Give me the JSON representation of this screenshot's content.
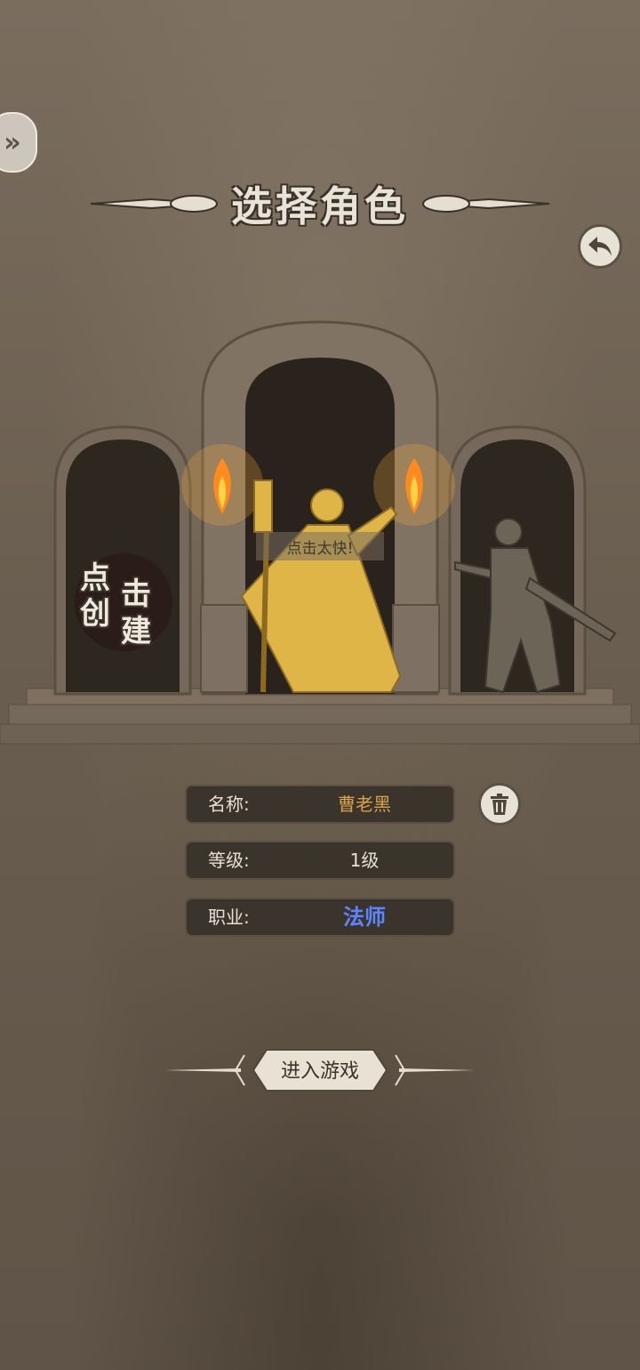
{
  "header": {
    "title": "选择角色"
  },
  "create_slot": {
    "line1": "点",
    "line2": "击",
    "line3": "创",
    "line4": "建"
  },
  "speech_bubble": "点击太快!",
  "character": {
    "name_label": "名称:",
    "name_value": "曹老黑",
    "level_label": "等级:",
    "level_value": "1级",
    "class_label": "职业:",
    "class_value": "法师"
  },
  "enter_button": "进入游戏",
  "icons": {
    "side": "double-chevron-right-icon",
    "back": "back-arrow-icon",
    "delete": "trash-icon"
  },
  "colors": {
    "name_value": "#d9a24a",
    "class_value": "#5c86ff",
    "hero_gold": "#e0b547",
    "fire": "#ff8a1e"
  }
}
